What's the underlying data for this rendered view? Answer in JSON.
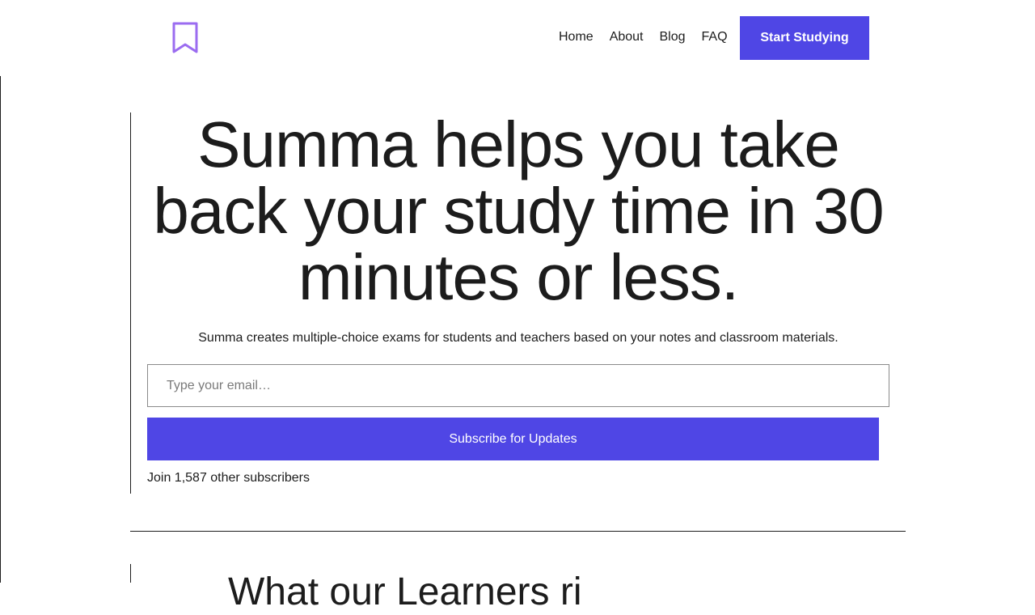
{
  "header": {
    "logo_icon": "bookmark-icon",
    "logo_color": "#9b6cf0",
    "nav": {
      "home": "Home",
      "about": "About",
      "blog": "Blog",
      "faq": "FAQ"
    },
    "cta_label": "Start Studying",
    "accent_color": "#4f46e5"
  },
  "hero": {
    "title": "Summa helps you take back your study time in 30 minutes or less.",
    "subtitle": "Summa creates multiple-choice exams for students and teachers based on your notes and classroom materials.",
    "email_placeholder": "Type your email…",
    "email_value": "",
    "subscribe_label": "Subscribe for Updates",
    "subscriber_text": "Join 1,587 other subscribers"
  },
  "next_section": {
    "heading": "What our Learners ri"
  }
}
